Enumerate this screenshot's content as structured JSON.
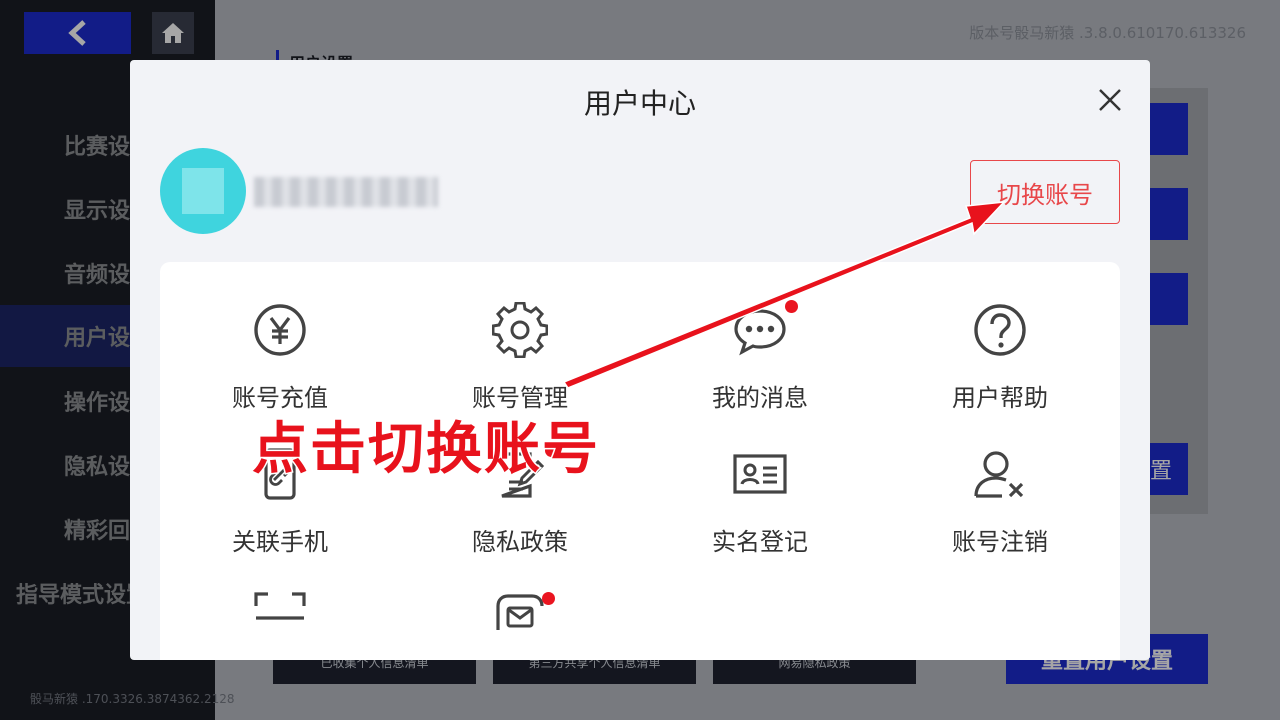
{
  "app": {
    "version": "版本号骰马新猿 .3.8.0.610170.613326",
    "footer_build": "骰马新猿 .170.3326.3874362.2128",
    "section_title": "用户设置"
  },
  "sidebar": {
    "items": [
      {
        "label": "比赛设置",
        "active": false
      },
      {
        "label": "显示设置",
        "active": false
      },
      {
        "label": "音频设置",
        "active": false
      },
      {
        "label": "用户设置",
        "active": true
      },
      {
        "label": "操作设置",
        "active": false
      },
      {
        "label": "隐私设置",
        "active": false
      },
      {
        "label": "精彩回放",
        "active": false
      },
      {
        "label": "指导模式设置",
        "active": false
      }
    ]
  },
  "background_buttons": {
    "bottom": [
      "已收集个人信息清单",
      "第三方共享个人信息清单",
      "网易隐私政策"
    ],
    "reset": "重置用户设置",
    "right_partial": [
      "置"
    ]
  },
  "modal": {
    "title": "用户中心",
    "switch_account": "切换账号",
    "grid": [
      {
        "label": "账号充值",
        "icon": "yuan-icon",
        "dot": false
      },
      {
        "label": "账号管理",
        "icon": "gear-icon",
        "dot": false
      },
      {
        "label": "我的消息",
        "icon": "chat-icon",
        "dot": true
      },
      {
        "label": "用户帮助",
        "icon": "help-icon",
        "dot": false
      },
      {
        "label": "关联手机",
        "icon": "phone-link-icon",
        "dot": false
      },
      {
        "label": "隐私政策",
        "icon": "document-edit-icon",
        "dot": true
      },
      {
        "label": "实名登记",
        "icon": "id-card-icon",
        "dot": false
      },
      {
        "label": "账号注销",
        "icon": "user-remove-icon",
        "dot": false
      },
      {
        "label": "",
        "icon": "scan-icon",
        "dot": false
      },
      {
        "label": "",
        "icon": "mail-box-icon",
        "dot": true
      }
    ]
  },
  "annotation": {
    "text": "点击切换账号",
    "color": "#e8121c"
  },
  "colors": {
    "accent_blue": "#1d2bd0",
    "alert_red": "#e8474a",
    "avatar_cyan": "#3fd4de"
  }
}
